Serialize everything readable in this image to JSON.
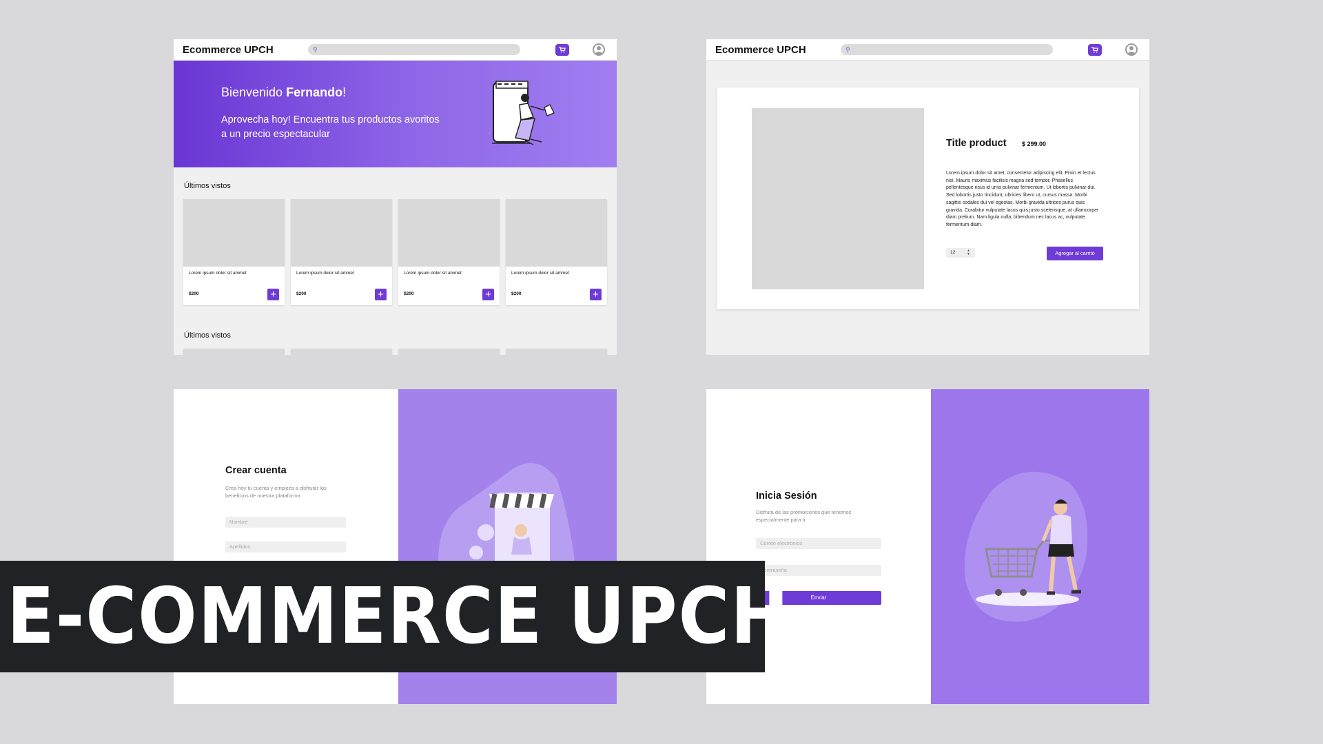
{
  "store": {
    "brand": "Ecommerce UPCH",
    "colors": {
      "accent": "#6f3bd6",
      "hero_start": "#6a35d4",
      "hero_end": "#a07ef0",
      "side_panel": "#a482ec",
      "banner": "#202226"
    }
  },
  "home": {
    "greeting": "Bienvenido ",
    "user_name": "Fernando",
    "greeting_end": "!",
    "subtitle": "Aprovecha hoy! Encuentra tus productos avoritos a un precio espectacular",
    "section_recent": "Últimos vistos",
    "section_recent_2": "Últimos vistos",
    "products": [
      {
        "name": "Lorem ipsum dolor sit ammet",
        "price": "$200"
      },
      {
        "name": "Lorem ipsum dolor sit ammet",
        "price": "$200"
      },
      {
        "name": "Lorem ipsum dolor sit ammet",
        "price": "$200"
      },
      {
        "name": "Lorem ipsum dolor sit ammet",
        "price": "$200"
      }
    ],
    "add_label": "+"
  },
  "product": {
    "title": "Title product",
    "price": "$ 299.00",
    "description": "Lorem ipsum dolor sit amet, consectetur adipiscing elit. Proin et lectus nisi. Mauris maximus facilisis magna sed tempor. Phasellus pellentesque risus id urna pulvinar fermentum. Ut lobortis pulvinar dui. Sed lobortis justo tincidunt, ultricies libero ut, cursus massa. Morbi sagittis sodales dui vel egestas. Morbi gravida ultrices purus quis gravida. Curabitur vulputate lacus quis justo scelerisque, at ullamcorper diam pretium. Nam ligula nulla, bibendum nec lacus ac, vulputate fermentum diam.",
    "quantity": "12",
    "add_to_cart": "Agregar al carrito"
  },
  "register": {
    "title": "Crear cuenta",
    "subtitle": "Crea hoy tu cuenta y empieza a disfrutar los beneficios de nuestra plataforma",
    "name_placeholder": "Nombre",
    "lastname_placeholder": "Apellidos"
  },
  "login": {
    "title": "Inicia Sesión",
    "subtitle": "Disfruta de las promociones que tenemos especialmente para ti",
    "email_placeholder": "Correo electronico",
    "password_placeholder": "Contraseña",
    "submit": "Enviar"
  },
  "banner": {
    "text": "E-COMMERCE UPCH"
  },
  "icons": [
    "search-icon",
    "cart-icon",
    "user-icon",
    "plus-icon",
    "chevron-spinner-icon"
  ]
}
